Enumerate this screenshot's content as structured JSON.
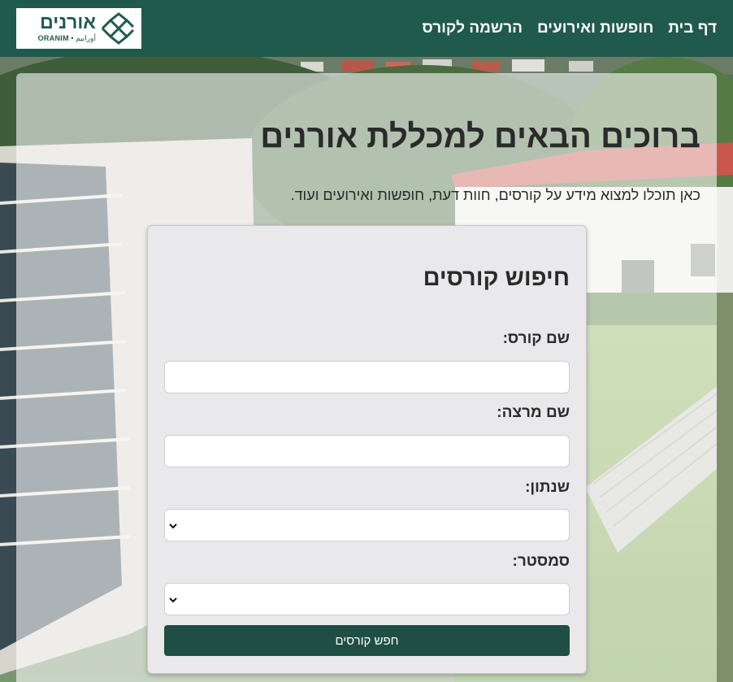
{
  "header": {
    "nav": [
      {
        "label": "דף בית"
      },
      {
        "label": "חופשות ואירועים"
      },
      {
        "label": "הרשמה לקורס"
      }
    ],
    "logo": {
      "hebrew": "אורנים",
      "english": "ORANIM",
      "arabic": "أورانيم",
      "separator": "•"
    }
  },
  "hero": {
    "title": "ברוכים הבאים למכללת אורנים",
    "subtitle": "כאן תוכלו למצוא מידע על קורסים, חוות דעת, חופשות ואירועים ועוד."
  },
  "search": {
    "title": "חיפוש קורסים",
    "course_name_label": "שם קורס:",
    "course_name_value": "",
    "lecturer_label": "שם מרצה:",
    "lecturer_value": "",
    "yearbook_label": "שנתון:",
    "yearbook_selected": "",
    "semester_label": "סמסטר:",
    "semester_selected": "",
    "submit_label": "חפש קורסים"
  },
  "colors": {
    "brand_green": "#1f5a4d",
    "button_green": "#1f4f44"
  }
}
